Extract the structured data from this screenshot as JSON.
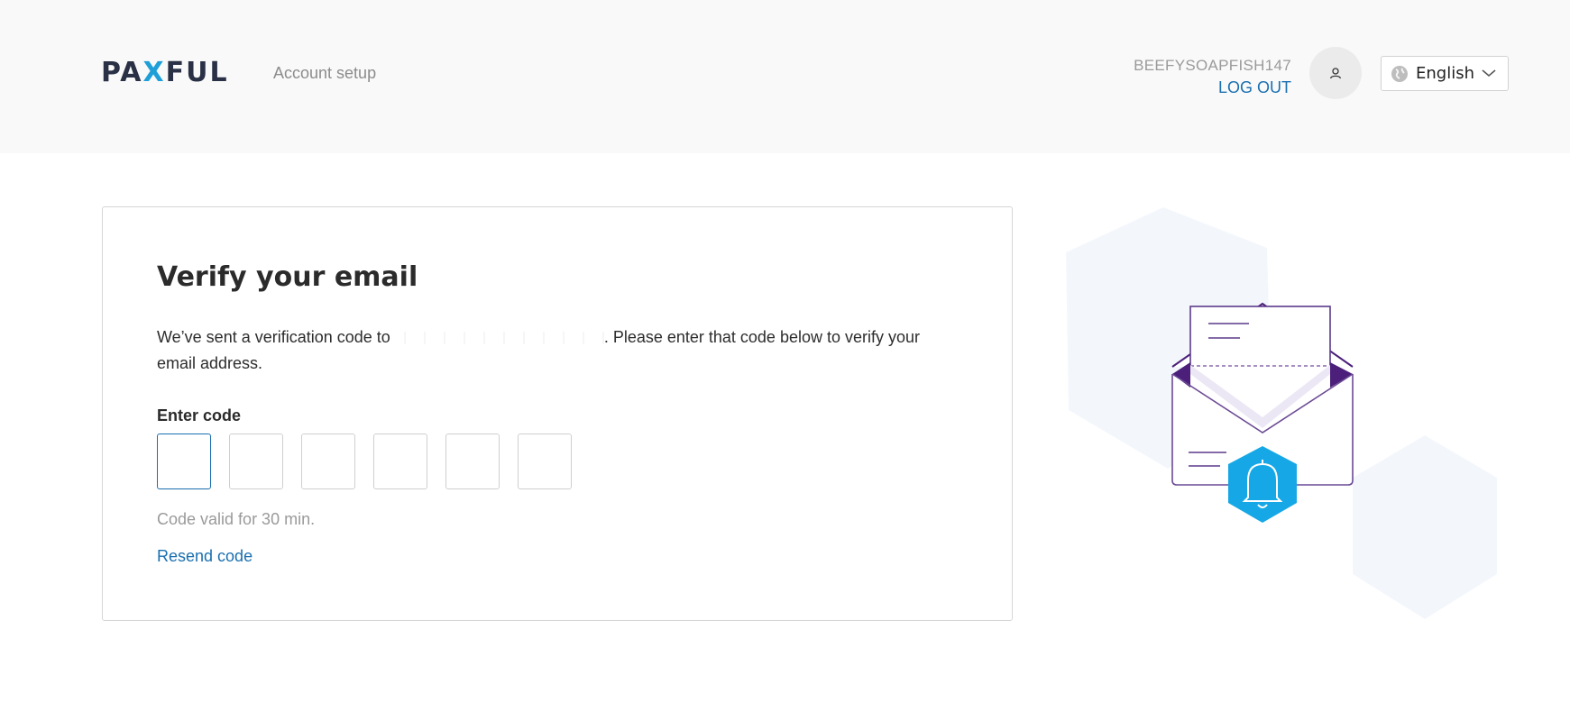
{
  "header": {
    "logo": {
      "part1": "PA",
      "x": "X",
      "part2": "FUL"
    },
    "section_title": "Account setup",
    "username": "BEEFYSOAPFISH147",
    "logout_label": "LOG OUT",
    "language": "English",
    "icons": {
      "avatar": "user-icon",
      "language": "globe-icon",
      "dropdown": "chevron-down-icon"
    }
  },
  "card": {
    "title": "Verify your email",
    "description_before": "We’ve sent a verification code to ",
    "description_after": ". Please enter that code below to verify your email address.",
    "code_label": "Enter code",
    "code_boxes": [
      "",
      "",
      "",
      "",
      "",
      ""
    ],
    "validity_text": "Code valid for 30 min.",
    "resend_label": "Resend code"
  },
  "illustration": {
    "icon": "envelope-bell-icon"
  },
  "colors": {
    "accent": "#1a6fb0",
    "brand_dark": "#2a3146",
    "bell_blue": "#16a8e6",
    "envelope_purple": "#4b1f7a"
  }
}
